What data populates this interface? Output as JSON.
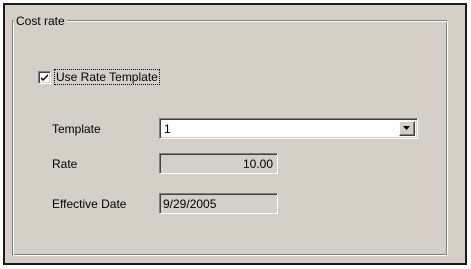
{
  "cost_rate": {
    "group_title": "Cost rate",
    "use_rate_template": {
      "label": "Use Rate Template",
      "checked": true
    },
    "template": {
      "label": "Template",
      "value": "1"
    },
    "rate": {
      "label": "Rate",
      "value": "10.00"
    },
    "effective_date": {
      "label": "Effective Date",
      "value": "9/29/2005"
    }
  },
  "icons": {
    "checkmark": "check-icon",
    "dropdown": "chevron-down-icon"
  },
  "colors": {
    "panel_background": "#d4d0c8",
    "field_background": "#ffffff",
    "frame_border": "#1a1a1a"
  }
}
